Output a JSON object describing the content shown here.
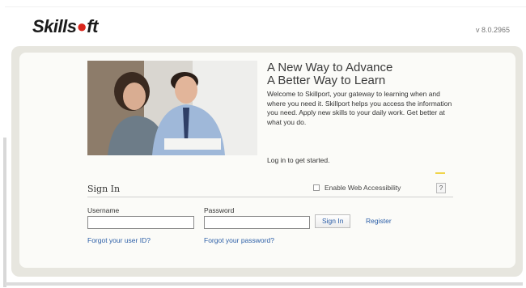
{
  "brand": {
    "logo_text_pre": "Skills",
    "logo_text_post": "ft",
    "version": "v 8.0.2965"
  },
  "promo": {
    "headline_line1": "A New Way to Advance",
    "headline_line2": "A Better Way to Learn",
    "description": "Welcome to Skillport, your gateway to learning when and where you need it. Skillport helps you access the information you need. Apply new skills to your daily work. Get better at what you do.",
    "cta_text": "Log in to get started."
  },
  "signin": {
    "title": "Sign In",
    "accessibility_label": "Enable Web Accessibility",
    "accessibility_checked": false,
    "help_label": "?",
    "username_label": "Username",
    "username_value": "",
    "password_label": "Password",
    "password_value": "",
    "signin_button": "Sign In",
    "register_link": "Register",
    "forgot_user_link": "Forgot your user ID?",
    "forgot_password_link": "Forgot your password?"
  },
  "colors": {
    "brand_red": "#d9261c",
    "link_blue": "#2b5ea7",
    "panel_bg": "#e7e6df"
  }
}
